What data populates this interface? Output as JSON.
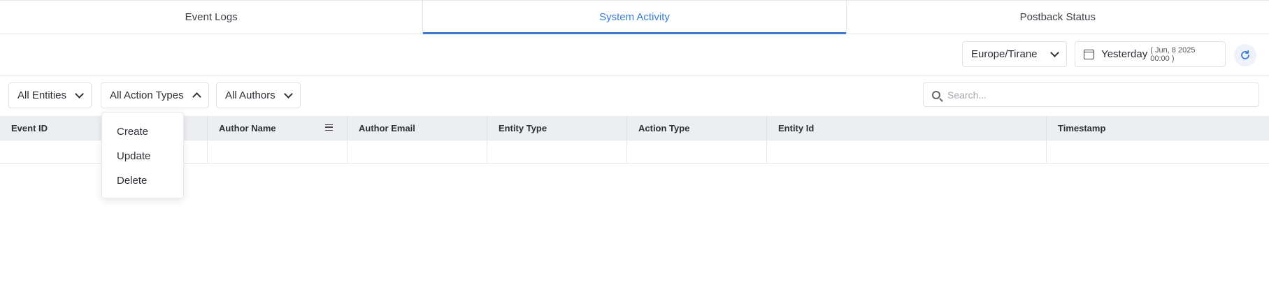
{
  "tabs": [
    {
      "label": "Event Logs",
      "active": false
    },
    {
      "label": "System Activity",
      "active": true
    },
    {
      "label": "Postback Status",
      "active": false
    }
  ],
  "toolbar": {
    "timezone": "Europe/Tirane",
    "date_label": "Yesterday",
    "date_sub": "( Jun, 8 2025 00:00 )"
  },
  "filters": {
    "entities": "All Entities",
    "action_types": "All Action Types",
    "authors": "All Authors",
    "search_placeholder": "Search..."
  },
  "dropdown": {
    "items": [
      "Create",
      "Update",
      "Delete"
    ]
  },
  "table": {
    "columns": [
      "Event ID",
      "",
      "Author Name",
      "Author Email",
      "Entity Type",
      "Action Type",
      "Entity Id",
      "Timestamp"
    ]
  },
  "colors": {
    "accent": "#3a7bd5",
    "header_bg": "#eceef2",
    "border": "#e4e6ea"
  },
  "icons": {
    "calendar": "calendar-icon",
    "refresh": "refresh-icon",
    "search": "search-icon",
    "column_menu": "column-menu-icon",
    "chevron": "chevron-down-icon"
  }
}
